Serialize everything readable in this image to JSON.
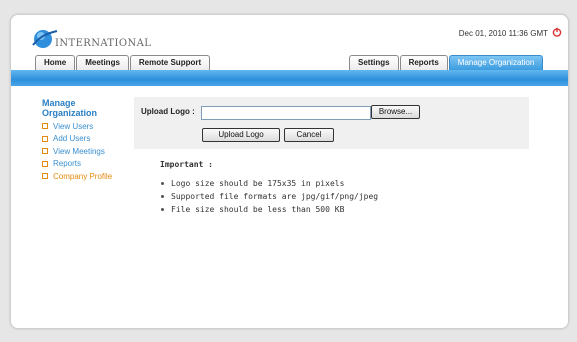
{
  "header": {
    "logo_text": "INTERNATIONAL",
    "datetime": "Dec 01, 2010 11:36 GMT"
  },
  "tabs_left": [
    {
      "label": "Home"
    },
    {
      "label": "Meetings"
    },
    {
      "label": "Remote Support"
    }
  ],
  "tabs_right": [
    {
      "label": "Settings"
    },
    {
      "label": "Reports"
    },
    {
      "label": "Manage Organization",
      "active": true
    }
  ],
  "sidebar": {
    "title_line1": "Manage",
    "title_line2": "Organization",
    "items": [
      {
        "label": "View Users"
      },
      {
        "label": "Add Users"
      },
      {
        "label": "View Meetings"
      },
      {
        "label": "Reports"
      },
      {
        "label": "Company Profile",
        "active": true
      }
    ]
  },
  "upload": {
    "label": "Upload Logo :",
    "file_value": "",
    "browse_label": "Browse...",
    "upload_button": "Upload Logo",
    "cancel_button": "Cancel"
  },
  "notes": {
    "title": "Important :",
    "items": [
      "Logo size should be 175x35 in pixels",
      "Supported file formats are jpg/gif/png/jpeg",
      "File size should be less than 500 KB"
    ]
  },
  "colors": {
    "band": "#2f8fdc",
    "active_tab": "#3c9be0",
    "sidebar_link": "#3a8fd0",
    "sidebar_active": "#e38a10"
  },
  "icons": {
    "logo": "globe-swoosh-icon",
    "power": "power-icon",
    "bullet": "square-bullet-icon"
  }
}
